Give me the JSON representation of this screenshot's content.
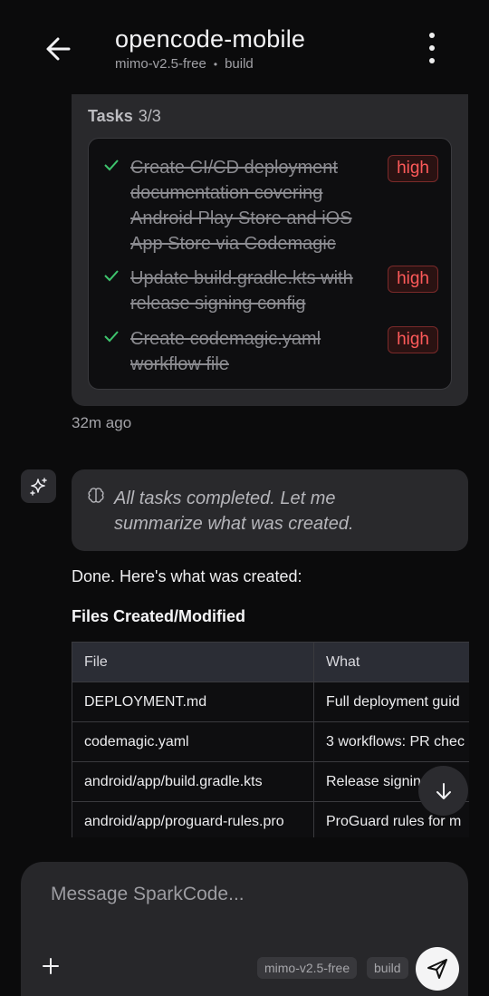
{
  "header": {
    "title": "opencode-mobile",
    "model": "mimo-v2.5-free",
    "separator": "•",
    "mode": "build"
  },
  "tasks": {
    "label": "Tasks",
    "count": "3/3",
    "items": [
      {
        "text": "Create CI/CD deployment documentation covering Android Play Store and iOS App Store via Codemagic",
        "priority": "high",
        "status": "completed"
      },
      {
        "text": "Update build.gradle.kts with release signing config",
        "priority": "high",
        "status": "completed"
      },
      {
        "text": "Create codemagic.yaml workflow file",
        "priority": "high",
        "status": "completed"
      }
    ],
    "timestamp": "32m ago"
  },
  "assistant": {
    "thinking": "All tasks completed. Let me summarize what was created.",
    "intro": "Done. Here's what was created:",
    "section_heading": "Files Created/Modified",
    "table": {
      "headers": [
        "File",
        "What"
      ],
      "rows": [
        [
          "DEPLOYMENT.md",
          "Full deployment guid"
        ],
        [
          "codemagic.yaml",
          "3 workflows: PR chec"
        ],
        [
          "android/app/build.gradle.kts",
          "Release signin"
        ],
        [
          "android/app/proguard-rules.pro",
          "ProGuard rules for m"
        ]
      ]
    }
  },
  "composer": {
    "placeholder": "Message SparkCode...",
    "model_chip": "mimo-v2.5-free",
    "mode_chip": "build"
  },
  "colors": {
    "background": "#0b0b0c",
    "card": "#29292c",
    "priority_high": "#ff5a5a",
    "check": "#3ec46d"
  }
}
